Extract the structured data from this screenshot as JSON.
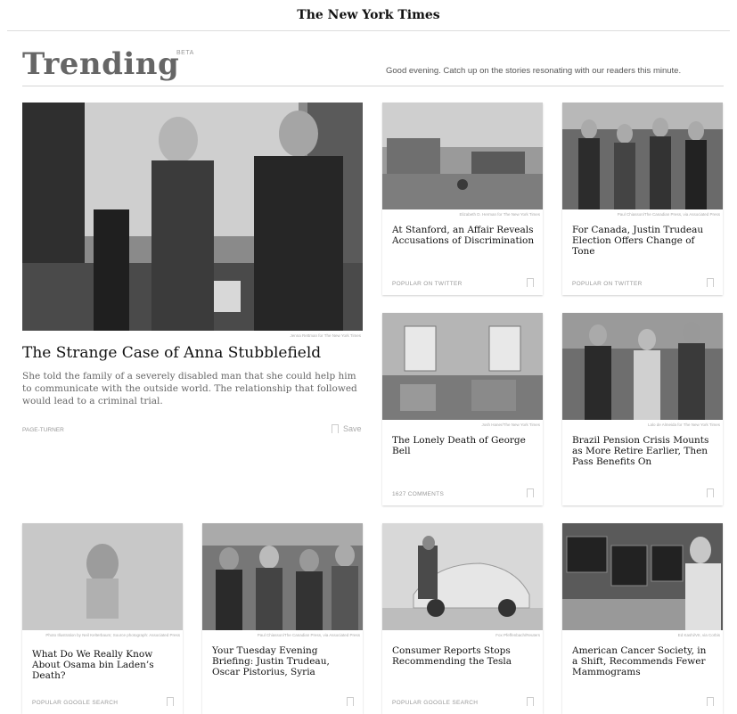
{
  "masthead": {
    "title": "The New York Times"
  },
  "header": {
    "title": "Trending",
    "badge": "BETA",
    "greeting": "Good evening. Catch up on the stories resonating with our readers this minute."
  },
  "feature": {
    "credit": "Jenna Rettman for The New York Times",
    "headline": "The Strange Case of Anna Stubblefield",
    "summary": "She told the family of a severely disabled man that she could help him to communicate with the outside world. The relationship that followed would lead to a criminal trial.",
    "tag": "PAGE-TURNER",
    "save_label": "Save"
  },
  "cards": [
    {
      "credit": "Elizabeth D. Herman for The New York Times",
      "headline": "At Stanford, an Affair Reveals Accusations of Discrimination",
      "tag": "POPULAR ON TWITTER"
    },
    {
      "credit": "Paul Chiasson/The Canadian Press, via Associated Press",
      "headline": "For Canada, Justin Trudeau Election Offers Change of Tone",
      "tag": "POPULAR ON TWITTER"
    },
    {
      "credit": "Josh Haner/The New York Times",
      "headline": "The Lonely Death of George Bell",
      "tag": "1627 COMMENTS"
    },
    {
      "credit": "Lalo de Almeida for The New York Times",
      "headline": "Brazil Pension Crisis Mounts as More Retire Earlier, Then Pass Benefits On",
      "tag": ""
    },
    {
      "credit": "Photo Illustration by Neil Kelterbaum; Source photograph: Associated Press",
      "headline": "What Do We Really Know About Osama bin Laden’s Death?",
      "tag": "POPULAR GOOGLE SEARCH"
    },
    {
      "credit": "Paul Chiasson/The Canadian Press, via Associated Press",
      "headline": "Your Tuesday Evening Briefing: Justin Trudeau, Oscar Pistorius, Syria",
      "tag": ""
    },
    {
      "credit": "Fox Pfeffenbach/Reuters",
      "headline": "Consumer Reports Stops Recommending the Tesla",
      "tag": "POPULAR GOOGLE SEARCH"
    },
    {
      "credit": "Ed Kashi/VII, via Corbis",
      "headline": "American Cancer Society, in a Shift, Recommends Fewer Mammograms",
      "tag": ""
    }
  ]
}
